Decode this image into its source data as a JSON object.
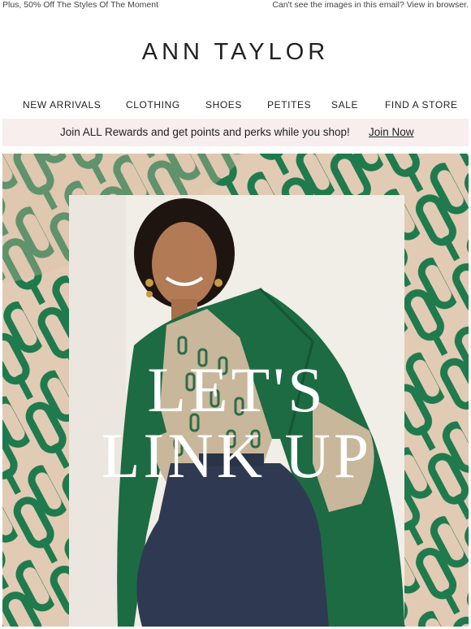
{
  "preheader": {
    "left_text": "Plus, 50% Off The Styles Of The Moment",
    "right_text": "Can't see the images in this email? View in browser."
  },
  "brand": {
    "logo_text": "ANN TAYLOR"
  },
  "nav": {
    "items": [
      {
        "label": "NEW ARRIVALS"
      },
      {
        "label": "CLOTHING"
      },
      {
        "label": "SHOES"
      },
      {
        "label": "PETITES"
      },
      {
        "label": "SALE"
      },
      {
        "label": "FIND A STORE"
      }
    ]
  },
  "rewards_banner": {
    "message": "Join ALL Rewards and get points and perks while you shop!",
    "link_label": "Join Now"
  },
  "hero": {
    "headline_line1": "LET'S",
    "headline_line2": "LINK UP",
    "pattern_color": "#1f7a4d",
    "pattern_background": "#e2cbb5",
    "jacket_color": "#1c6b42",
    "pants_color": "#2f3a52"
  }
}
